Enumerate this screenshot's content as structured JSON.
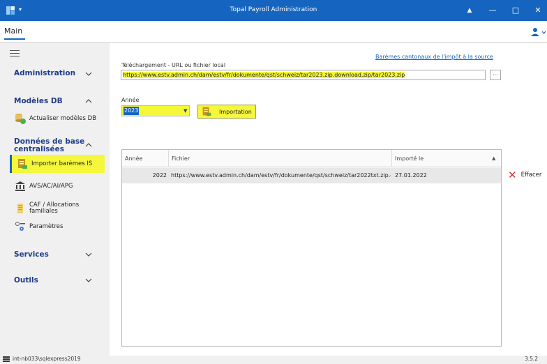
{
  "window": {
    "title": "Topal Payroll Administration",
    "menu_glyph": "▾",
    "notify_glyph": "▲",
    "minimize_glyph": "—",
    "maximize_glyph": "□",
    "close_glyph": "✕"
  },
  "tabs": {
    "main_label": "Main"
  },
  "sidebar": {
    "sections": {
      "administration": "Administration",
      "modeles_db": "Modèles DB",
      "donnees_base": "Données de base centralisées",
      "services": "Services",
      "outils": "Outils"
    },
    "items": {
      "actualiser": "Actualiser modèles DB",
      "importer": "Importer barèmes IS",
      "avs": "AVS/AC/AI/APG",
      "caf": "CAF / Allocations familiales",
      "parametres": "Paramètres"
    }
  },
  "content": {
    "download_label": "Téléchargement - URL ou fichier local",
    "baremes_link": "Barèmes cantonaux de l'impôt à la source",
    "url_value": "https://www.estv.admin.ch/dam/estv/fr/dokumente/qst/schweiz/tar2023.zip.download.zip/tar2023.zip",
    "browse_label": "...",
    "year_label": "Année",
    "year_value": "2023",
    "import_label": "Importation",
    "delete_label": "Effacer"
  },
  "grid": {
    "columns": [
      "Année",
      "Fichier",
      "Importé le"
    ],
    "rows": [
      {
        "annee": "2022",
        "fichier": "https://www.estv.admin.ch/dam/estv/fr/dokumente/qst/schweiz/tar2022txt.zip.d...",
        "importe_le": "27.01.2022"
      }
    ]
  },
  "status": {
    "db": "int-nb033\\sqlexpress2019",
    "version": "3.5.2"
  },
  "colors": {
    "accent": "#1565c0",
    "highlight": "#f5f73a",
    "delete": "#d32f2f"
  }
}
